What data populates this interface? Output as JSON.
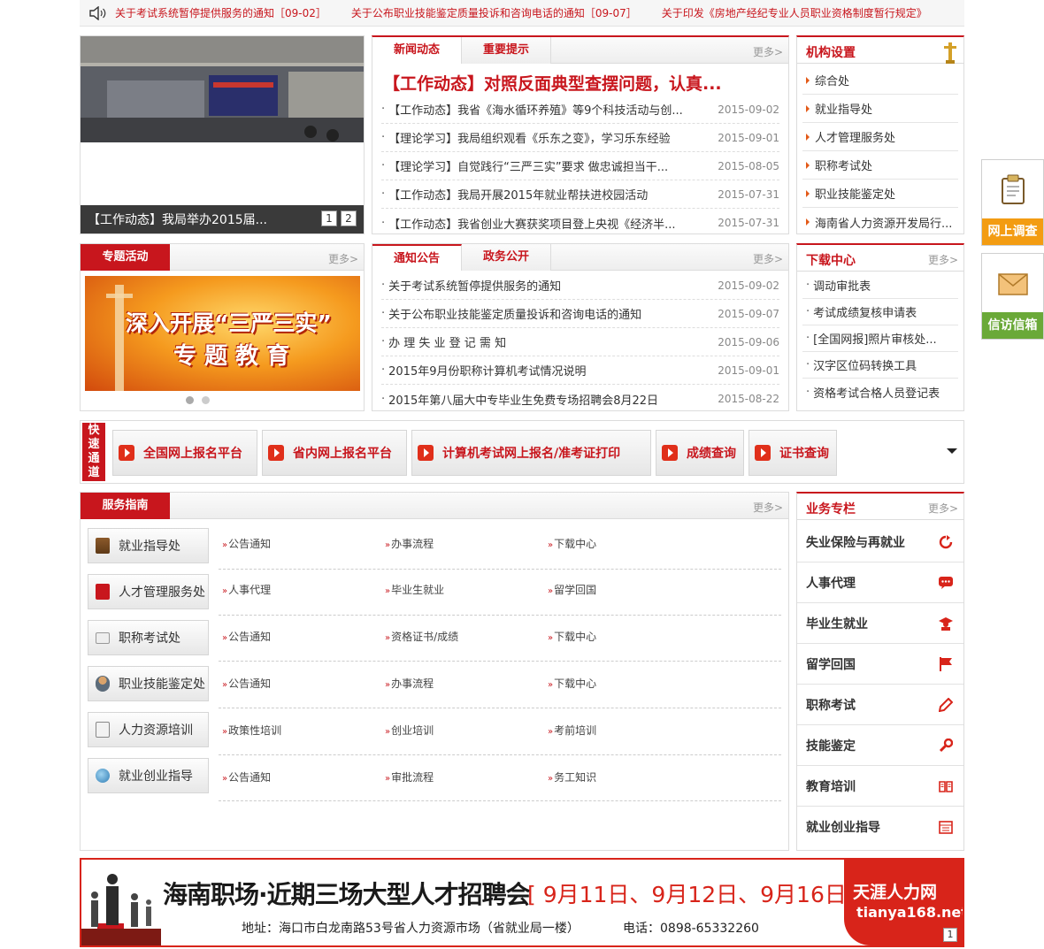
{
  "marquee": {
    "items": [
      "关于考试系统暂停提供服务的通知［09-02］",
      "关于公布职业技能鉴定质量投诉和咨询电话的通知［09-07］",
      "关于印发《房地产经纪专业人员职业资格制度暂行规定》"
    ]
  },
  "slider": {
    "caption": "【工作动态】我局举办2015届...",
    "pages": [
      "1",
      "2"
    ]
  },
  "news": {
    "tabs": [
      "新闻动态",
      "重要提示"
    ],
    "more": "更多>",
    "headline": "【工作动态】对照反面典型查摆问题，认真...",
    "items": [
      {
        "title": "【工作动态】我省《海水循环养殖》等9个科技活动与创...",
        "date": "2015-09-02"
      },
      {
        "title": "【理论学习】我局组织观看《乐东之变》，学习乐东经验",
        "date": "2015-09-01"
      },
      {
        "title": "【理论学习】自觉践行“三严三实”要求 做忠诚担当干...",
        "date": "2015-08-05"
      },
      {
        "title": "【工作动态】我局开展2015年就业帮扶进校园活动",
        "date": "2015-07-31"
      },
      {
        "title": "【工作动态】我省创业大赛获奖项目登上央视《经济半...",
        "date": "2015-07-31"
      }
    ]
  },
  "org": {
    "title": "机构设置",
    "items": [
      "综合处",
      "就业指导处",
      "人才管理服务处",
      "职称考试处",
      "职业技能鉴定处",
      "海南省人力资源开发局行..."
    ]
  },
  "special": {
    "title": "专题活动",
    "more": "更多>",
    "banner_line1": "深入开展“三严三实”",
    "banner_line2": "专 题 教 育"
  },
  "notice": {
    "tabs": [
      "通知公告",
      "政务公开"
    ],
    "more": "更多>",
    "items": [
      {
        "title": "关于考试系统暂停提供服务的通知",
        "date": "2015-09-02"
      },
      {
        "title": "关于公布职业技能鉴定质量投诉和咨询电话的通知",
        "date": "2015-09-07"
      },
      {
        "title": "办 理 失 业 登 记 需 知",
        "date": "2015-09-06"
      },
      {
        "title": "2015年9月份职称计算机考试情况说明",
        "date": "2015-09-01"
      },
      {
        "title": "2015年第八届大中专毕业生免费专场招聘会8月22日",
        "date": "2015-08-22"
      }
    ]
  },
  "download": {
    "title": "下载中心",
    "more": "更多>",
    "items": [
      "调动审批表",
      "考试成绩复核申请表",
      "[全国网报]照片审核处...",
      "汉字区位码转换工具",
      "资格考试合格人员登记表"
    ]
  },
  "quick": {
    "label": [
      "快",
      "速",
      "通",
      "道"
    ],
    "buttons": [
      "全国网上报名平台",
      "省内网上报名平台",
      "计算机考试网上报名/准考证打印",
      "成绩查询",
      "证书查询"
    ]
  },
  "guide": {
    "title": "服务指南",
    "more": "更多>",
    "rows": [
      {
        "name": "就业指导处",
        "icon": "book-icon",
        "links": [
          "公告通知",
          "办事流程",
          "下载中心"
        ]
      },
      {
        "name": "人才管理服务处",
        "icon": "party-icon",
        "links": [
          "人事代理",
          "毕业生就业",
          "留学回国"
        ]
      },
      {
        "name": "职称考试处",
        "icon": "mail-icon",
        "links": [
          "公告通知",
          "资格证书/成绩",
          "下载中心"
        ]
      },
      {
        "name": "职业技能鉴定处",
        "icon": "worker-icon",
        "links": [
          "公告通知",
          "办事流程",
          "下载中心"
        ]
      },
      {
        "name": "人力资源培训",
        "icon": "document-edit-icon",
        "links": [
          "政策性培训",
          "创业培训",
          "考前培训"
        ]
      },
      {
        "name": "就业创业指导",
        "icon": "globe-icon",
        "links": [
          "公告通知",
          "审批流程",
          "务工知识"
        ]
      }
    ]
  },
  "business": {
    "title": "业务专栏",
    "more": "更多>",
    "items": [
      {
        "name": "失业保险与再就业",
        "icon": "refresh-icon"
      },
      {
        "name": "人事代理",
        "icon": "chat-icon"
      },
      {
        "name": "毕业生就业",
        "icon": "graduate-icon"
      },
      {
        "name": "留学回国",
        "icon": "flag-icon"
      },
      {
        "name": "职称考试",
        "icon": "pencil-icon"
      },
      {
        "name": "技能鉴定",
        "icon": "wrench-icon"
      },
      {
        "name": "教育培训",
        "icon": "open-book-icon"
      },
      {
        "name": "就业创业指导",
        "icon": "calendar-icon"
      }
    ]
  },
  "ad": {
    "title": "海南职场·近期三场大型人才招聘会",
    "dates": "[ 9月11日、9月12日、9月16日 ]",
    "address": "地址：海口市白龙南路53号省人力资源市场（省就业局一楼）",
    "phone": "电话：0898-65332260",
    "brand": "天涯人力网",
    "brand_url": "tianya168.net",
    "page": "1"
  },
  "floats": [
    "网上调查",
    "信访信箱"
  ],
  "colors": {
    "accent": "#c8161d",
    "orange": "#e35a18",
    "green": "#6aa938"
  }
}
